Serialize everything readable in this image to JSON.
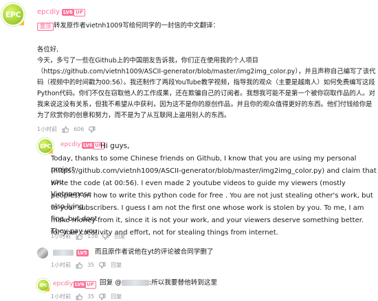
{
  "top_comment": {
    "avatar_text": "EPC",
    "username": "epcdiy",
    "level": "LV6",
    "up_badge": "UP",
    "pinned_label": "置顶",
    "title_line": "转发原作者vietnh1009写给何同学的一封信的中文翻译：",
    "greeting": "各位好,",
    "body_lines": [
      "今天，多亏了一些在Github上的中国朋友告诉我，你们正在使用我的个人项目",
      "（https://github.com/vietnh1009/ASCII-generator/blob/master/img2img_color.py），并且声称自己编写了该代",
      "码（视频中的时间戳为00:56）。我还制作了两段YouTube教学视频，指导我的观众（主要是越南人）如何免费编写这段",
      "Python代码。你们不仅在窃取他人的工作成果，还在欺骗自己的订阅者。我想我可能不是第一个被你窃取作品的人。对",
      "我来说这没有关系，但我不希望从中获利，因为这不是你的原创作品，并且你的观众值得更好的东西。他们付钱给你是",
      "为了欣赏你的创意和努力，而不是为了从互联网上盗用别人的东西。"
    ],
    "time": "1小时前",
    "likes": "606"
  },
  "replies": [
    {
      "avatar_text": "EPC",
      "username": "epcdiy",
      "level": "LV6",
      "up_badge": "UP",
      "greeting": "Hi guys,",
      "body_lines": [
        "Today, thanks to some Chinese friends on Github, I know that you are using my personal project",
        "(https://github.com/vietnh1009/ASCII-generator/blob/master/img2img_color.py) and claim that you",
        "write the code (at 00:56). I even made 2 youtube videos to guide my viewers (mostly Vietnamese",
        "peoples) on how to write this python code for free . You are not just stealing other's work, but also lying",
        "to your subscribers. I guess I am not the first one whose work is stolen by you. To me, I am fine, but dont",
        "make money from it, since it is not your work, and your viewers deserve something better. They pay you",
        "for your creativity and effort, not for stealing things from internet."
      ],
      "time": "1小时前",
      "likes": "138",
      "reply_label": "回复"
    },
    {
      "username_hidden": true,
      "level": "LV5",
      "text": "而且原作者说他在yt的评论被合同学删了",
      "time": "1小时前",
      "likes": "35",
      "reply_label": "回复"
    },
    {
      "avatar_text": "EPC",
      "username": "epcdiy",
      "level": "LV6",
      "up_badge": "UP",
      "reply_prefix": "回复 @",
      "text_suffix": ":所以我要替他转到这里",
      "time": "1小时前",
      "likes": "35",
      "reply_label": "回复"
    }
  ]
}
